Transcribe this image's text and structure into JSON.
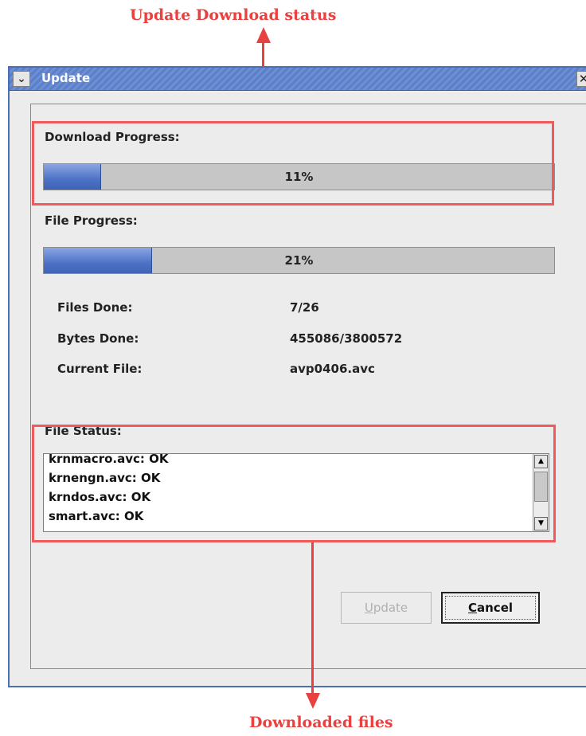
{
  "annotations": {
    "top_label": "Update Download status",
    "bottom_label": "Downloaded files",
    "colors": {
      "annotation": "#e8413f"
    }
  },
  "window": {
    "title": "Update",
    "menu_icon": "chevron-down-icon",
    "close_icon": "close-icon"
  },
  "download": {
    "label": "Download Progress:",
    "percent": 11,
    "percent_text": "11%"
  },
  "file": {
    "label": "File Progress:",
    "percent": 21,
    "percent_text": "21%"
  },
  "stats": [
    {
      "label": "Files Done:",
      "value": "7/26"
    },
    {
      "label": "Bytes Done:",
      "value": "455086/3800572"
    },
    {
      "label": "Current File:",
      "value": "avp0406.avc"
    }
  ],
  "file_status": {
    "label": "File Status:",
    "items": [
      "krnmacro.avc: OK",
      "krnengn.avc: OK",
      "krndos.avc: OK",
      "smart.avc: OK"
    ]
  },
  "buttons": {
    "update_prefix": "",
    "update_mnemonic": "U",
    "update_rest": "pdate",
    "cancel_mnemonic": "C",
    "cancel_rest": "ancel"
  },
  "colors": {
    "progress_fill": "#4d72c6",
    "titlebar": "#5b7fc8"
  }
}
